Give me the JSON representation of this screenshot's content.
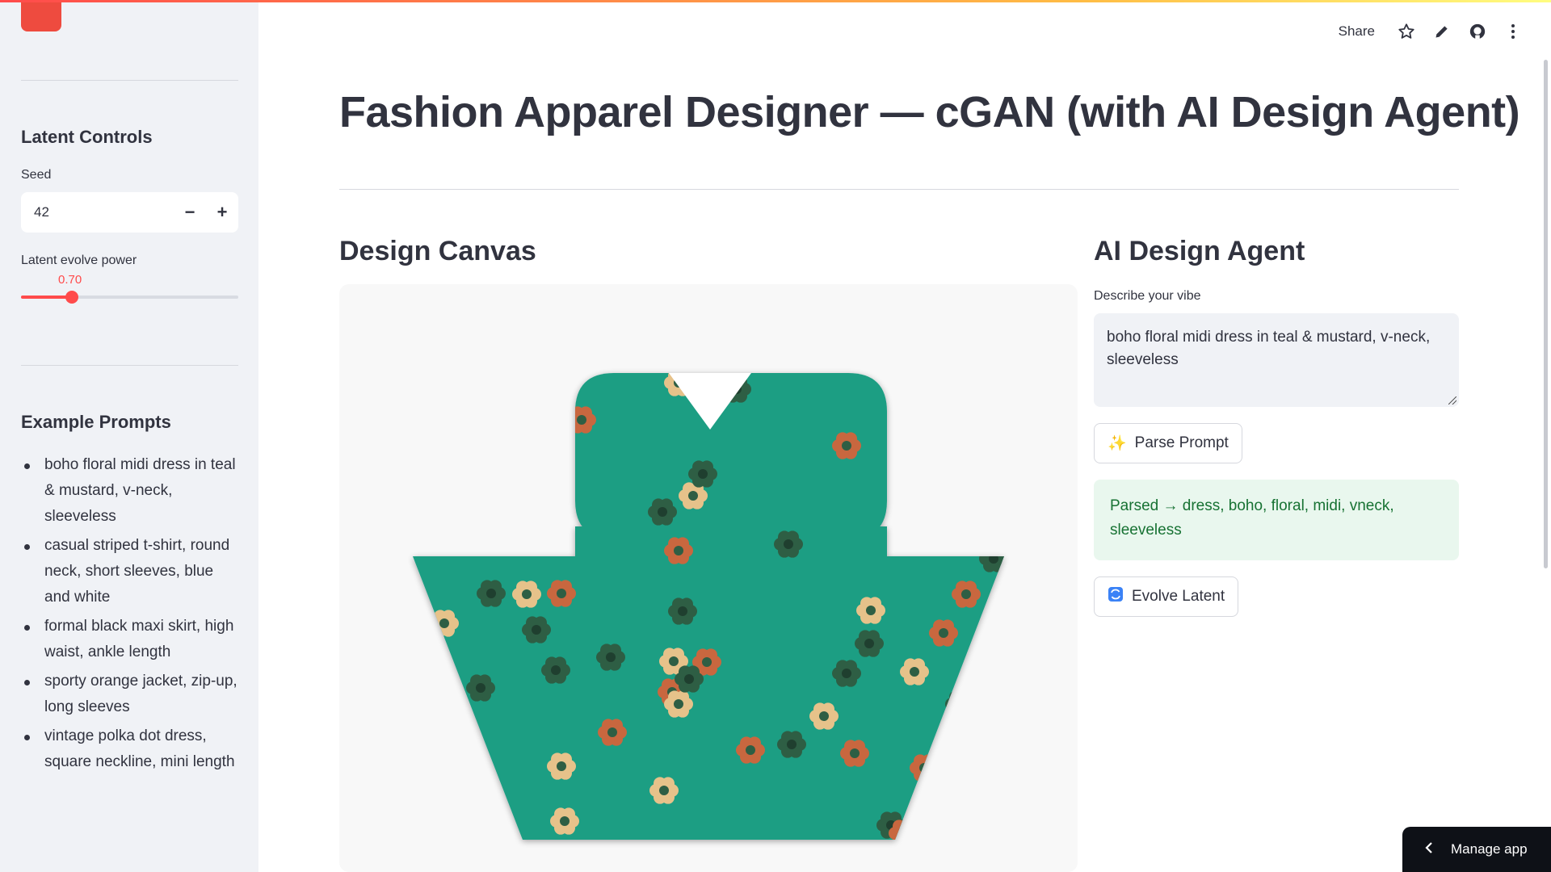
{
  "sidebar": {
    "latent_controls_heading": "Latent Controls",
    "seed_label": "Seed",
    "seed_value": "42",
    "seed_decrement": "−",
    "seed_increment": "+",
    "evolve_label": "Latent evolve power",
    "evolve_value_text": "0.70",
    "evolve_fraction": 0.235,
    "examples_heading": "Example Prompts",
    "examples": [
      "boho floral midi dress in teal & mustard, v-neck, sleeveless",
      "casual striped t-shirt, round neck, short sleeves, blue and white",
      "formal black maxi skirt, high waist, ankle length",
      "sporty orange jacket, zip-up, long sleeves",
      "vintage polka dot dress, square neckline, mini length"
    ]
  },
  "header": {
    "share_label": "Share",
    "icons": [
      "star-icon",
      "pencil-icon",
      "github-icon",
      "more-vert-icon"
    ]
  },
  "main": {
    "title": "Fashion Apparel Designer — cGAN (with AI Design Agent)",
    "canvas_heading": "Design Canvas",
    "agent_heading": "AI Design Agent",
    "vibe_label": "Describe your vibe",
    "vibe_text": "boho floral midi dress in teal & mustard, v-neck, sleeveless",
    "parse_button": "Parse Prompt",
    "parse_icon": "sparkles-icon",
    "parsed_result": "Parsed → dress, boho, floral, midi, vneck, sleeveless",
    "evolve_button": "Evolve Latent",
    "evolve_icon": "refresh-icon"
  },
  "manage_app": "Manage app",
  "colors": {
    "accent": "#ff4b4b",
    "garment": "#1a9e83",
    "flower_dark": "#2e5e44",
    "flower_rust": "#c8673f",
    "flower_sand": "#e6c28a",
    "success_bg": "#e9f7ee",
    "success_text": "#177233"
  }
}
